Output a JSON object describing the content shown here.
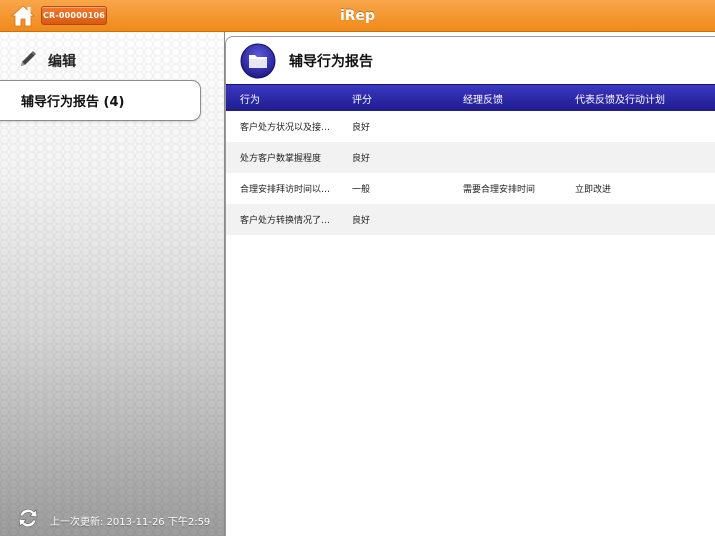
{
  "header": {
    "title": "iRep",
    "record_id": "CR-00000106"
  },
  "sidebar": {
    "edit_label": "编辑",
    "report_item_label": "辅导行为报告 (4)",
    "last_updated": "上一次更新: 2013-11-26 下午2:59"
  },
  "main": {
    "title": "辅导行为报告",
    "columns": [
      "行为",
      "评分",
      "经理反馈",
      "代表反馈及行动计划"
    ],
    "rows": [
      [
        "客户处方状况以及接…",
        "良好",
        "",
        ""
      ],
      [
        "处方客户数掌握程度",
        "良好",
        "",
        ""
      ],
      [
        "合理安排拜访时间以…",
        "一般",
        "需要合理安排时间",
        "立即改进"
      ],
      [
        "客户处方转换情况了…",
        "良好",
        "",
        ""
      ]
    ]
  },
  "colors": {
    "topbar": "#f39a32",
    "table_header": "#2b27a8",
    "badge": "#e2661f"
  },
  "icons": [
    "home-icon",
    "pencil-icon",
    "folder-icon",
    "sync-icon"
  ]
}
